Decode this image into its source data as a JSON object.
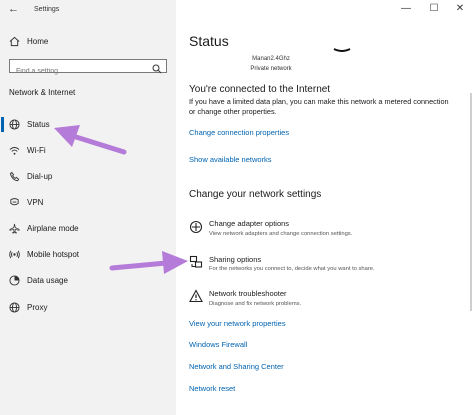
{
  "window": {
    "title": "Settings",
    "back_glyph": "←",
    "minimize_glyph": "—",
    "maximize_glyph": "☐",
    "close_glyph": "✕"
  },
  "sidebar": {
    "home_label": "Home",
    "search_placeholder": "Find a setting",
    "section_title": "Network & Internet",
    "items": [
      {
        "label": "Status",
        "icon": "globe-icon"
      },
      {
        "label": "Wi-Fi",
        "icon": "wifi-icon"
      },
      {
        "label": "Dial-up",
        "icon": "phone-icon"
      },
      {
        "label": "VPN",
        "icon": "vpn-icon"
      },
      {
        "label": "Airplane mode",
        "icon": "airplane-icon"
      },
      {
        "label": "Mobile hotspot",
        "icon": "hotspot-icon"
      },
      {
        "label": "Data usage",
        "icon": "data-usage-icon"
      },
      {
        "label": "Proxy",
        "icon": "globe-icon"
      }
    ],
    "active_index": 0
  },
  "main": {
    "title": "Status",
    "network_name": "Manan2.4Ghz",
    "network_type": "Private network",
    "connected_heading": "You're connected to the Internet",
    "connected_text": "If you have a limited data plan, you can make this network a metered connection or change other properties.",
    "change_properties_link": "Change connection properties",
    "show_networks_link": "Show available networks",
    "change_settings_heading": "Change your network settings",
    "options": [
      {
        "title": "Change adapter options",
        "desc": "View network adapters and change connection settings.",
        "icon": "adapter-icon"
      },
      {
        "title": "Sharing options",
        "desc": "For the networks you connect to, decide what you want to share.",
        "icon": "sharing-icon"
      },
      {
        "title": "Network troubleshooter",
        "desc": "Diagnose and fix network problems.",
        "icon": "warning-icon"
      }
    ],
    "links": [
      "View your network properties",
      "Windows Firewall",
      "Network and Sharing Center",
      "Network reset"
    ]
  },
  "colors": {
    "accent": "#0063b1",
    "sidebar_bg": "#f2f2f2",
    "annotation_arrow": "#b57bd8"
  }
}
